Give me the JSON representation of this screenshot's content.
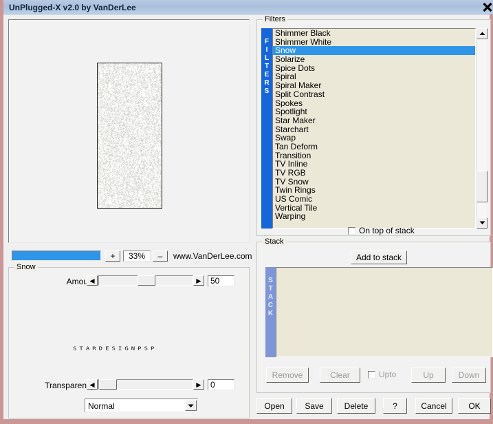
{
  "window": {
    "title": "UnPlugged-X v2.0 by VanDerLee",
    "close_icon": "close-icon",
    "frame_color": "#cb9696",
    "titlebar_color": "#aec4e0"
  },
  "preview": {
    "watermark": "STARDESIGNPSP",
    "image_alt": "snow-noise-preview"
  },
  "zoom": {
    "plus_label": "+",
    "minus_label": "–",
    "value": "33%",
    "fill_percent": 100,
    "website": "www.VanDerLee.com"
  },
  "snow_group": {
    "legend": "Snow",
    "amount": {
      "label": "Amount",
      "value": "50",
      "thumb_percent": 50,
      "left_arrow": "◄",
      "right_arrow": "►"
    },
    "transparency": {
      "label": "Transparency",
      "value": "0",
      "thumb_percent": 0,
      "left_arrow": "◄",
      "right_arrow": "►"
    },
    "blend_mode": {
      "selected": "Normal",
      "arrow": "▼"
    }
  },
  "filters": {
    "legend": "Filters",
    "strip_label": "FILTERS",
    "strip_letters": [
      "F",
      "I",
      "L",
      "T",
      "E",
      "R",
      "S"
    ],
    "selected": "Snow",
    "items": [
      "Shimmer Black",
      "Shimmer White",
      "Snow",
      "Solarize",
      "Spice Dots",
      "Spiral",
      "Spiral Maker",
      "Split Contrast",
      "Spokes",
      "Spotlight",
      "Star Maker",
      "Starchart",
      "Swap",
      "Tan Deform",
      "Transition",
      "TV Inline",
      "TV RGB",
      "TV Snow",
      "Twin Rings",
      "US Comic",
      "Vertical Tile",
      "Warping"
    ],
    "scroll_up_icon": "triangle-up-icon",
    "scroll_down_icon": "triangle-down-icon",
    "on_top_checkbox": {
      "label": "On top of stack",
      "checked": false
    }
  },
  "stack": {
    "legend": "Stack",
    "strip_label": "STACK",
    "strip_letters": [
      "S",
      "T",
      "A",
      "C",
      "K"
    ],
    "add_button": "Add to stack",
    "items": [],
    "controls": {
      "remove": "Remove",
      "clear": "Clear",
      "upto_label": "Upto",
      "upto_checked": false,
      "up": "Up",
      "down": "Down"
    }
  },
  "bottom_buttons": {
    "open": "Open",
    "save": "Save",
    "delete": "Delete",
    "help": "?",
    "cancel": "Cancel",
    "ok": "OK"
  }
}
